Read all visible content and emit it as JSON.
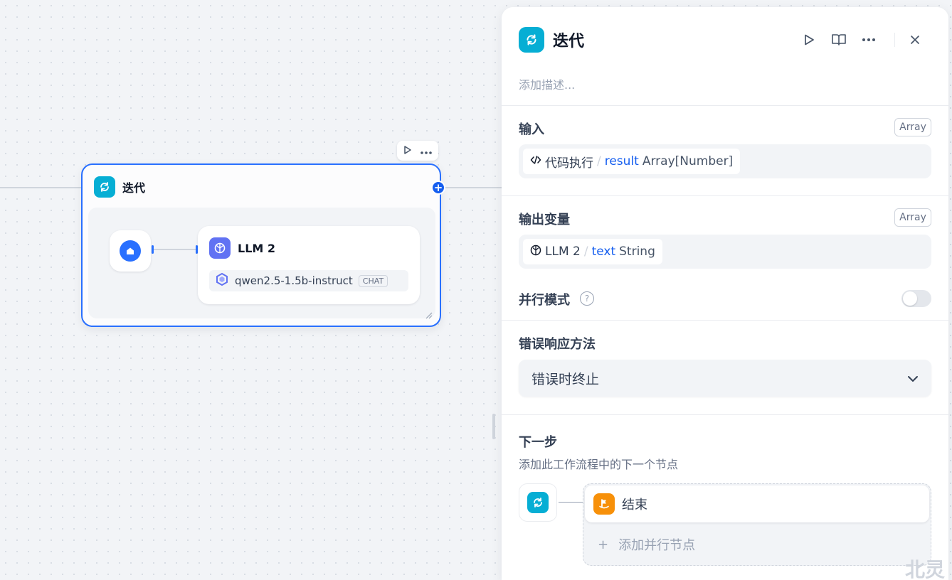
{
  "canvas": {
    "iteration_node": {
      "title": "迭代",
      "add_handle": "+",
      "children": {
        "llm": {
          "title": "LLM 2",
          "model": "qwen2.5-1.5b-instruct",
          "model_tag": "CHAT"
        }
      }
    }
  },
  "panel": {
    "title": "迭代",
    "description_placeholder": "添加描述...",
    "input": {
      "label": "输入",
      "type": "Array",
      "var": {
        "node": "代码执行",
        "slash": "/",
        "name": "result",
        "type": "Array[Number]"
      }
    },
    "output": {
      "label": "输出变量",
      "type": "Array",
      "var": {
        "node": "LLM 2",
        "slash": "/",
        "name": "text",
        "type": "String"
      }
    },
    "parallel": {
      "label": "并行模式",
      "help": "?",
      "enabled": false
    },
    "error": {
      "label": "错误响应方法",
      "selected": "错误时终止"
    },
    "next": {
      "title": "下一步",
      "subtitle": "添加此工作流程中的下一个节点",
      "items": [
        {
          "label": "结束"
        }
      ],
      "add_parallel_icon": "+",
      "add_parallel_label": "添加并行节点"
    }
  },
  "watermark": "北灵",
  "colors": {
    "accent": "#155eef",
    "iteration": "#06aed4",
    "llm": "#6172f3",
    "end": "#f79009"
  }
}
